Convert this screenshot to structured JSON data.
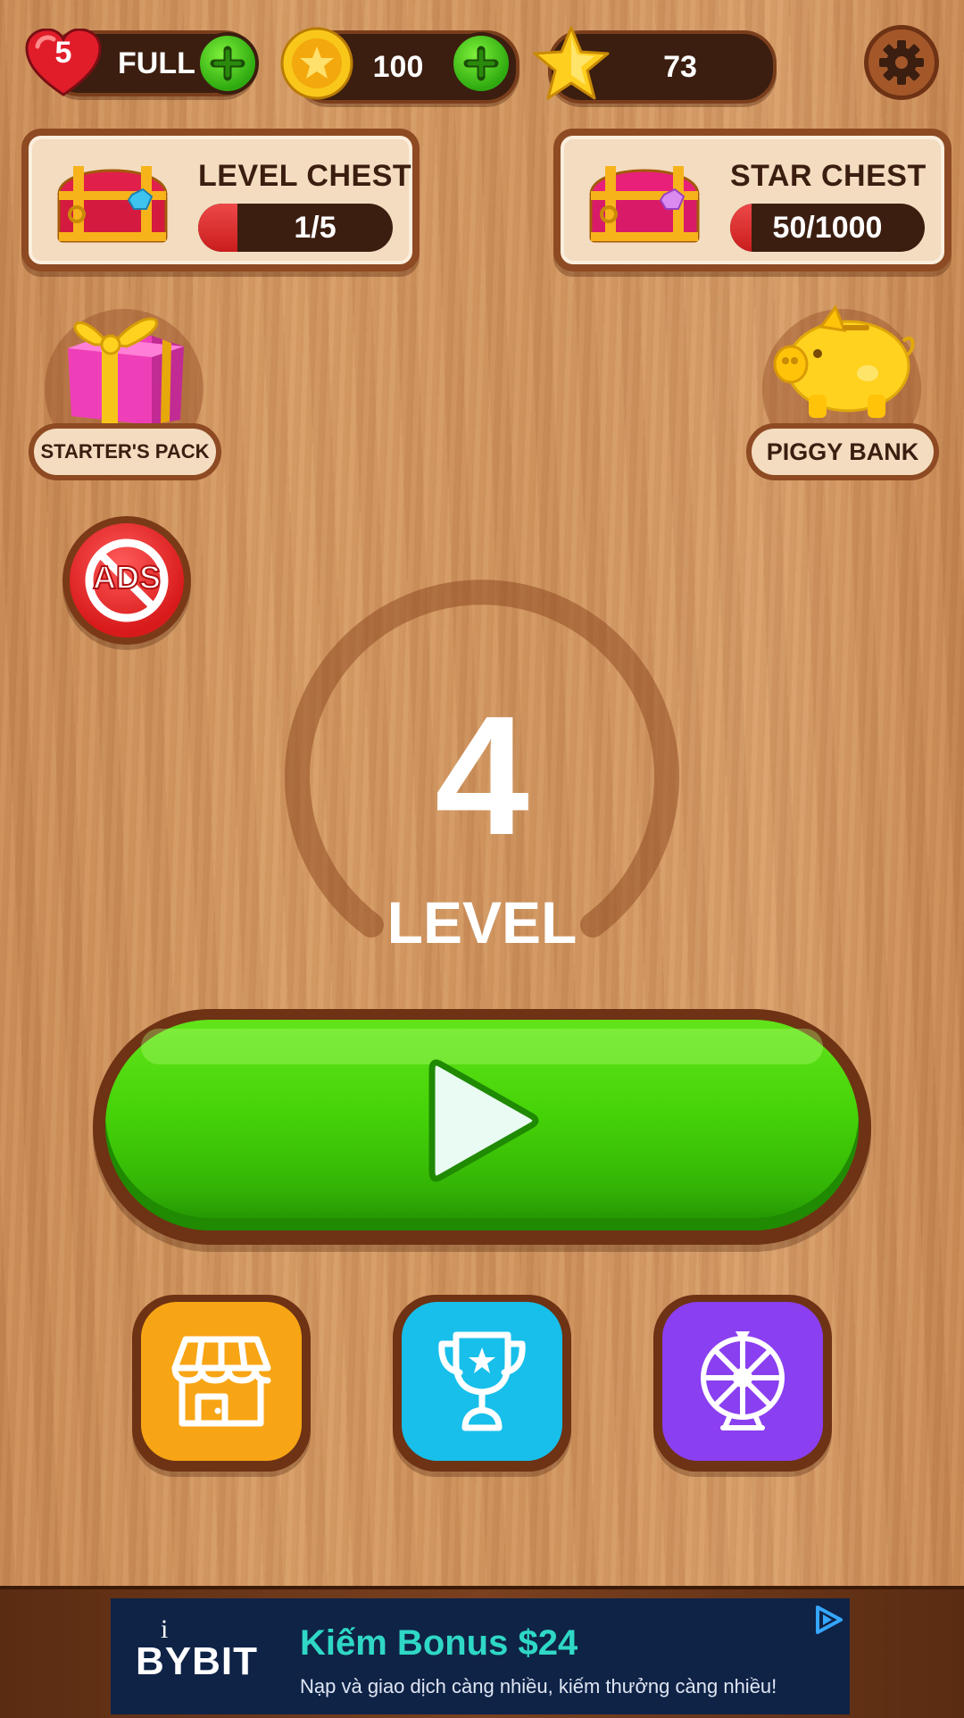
{
  "topbar": {
    "lives_count": "5",
    "lives_status": "FULL",
    "coins": "100",
    "stars": "73",
    "icons": [
      "heart-icon",
      "coin-icon",
      "star-icon",
      "plus-icon",
      "gear-icon"
    ]
  },
  "chests": {
    "level": {
      "title": "LEVEL CHEST",
      "progress_text": "1/5",
      "progress": 0.2
    },
    "star": {
      "title": "STAR CHEST",
      "progress_text": "50/1000",
      "progress": 0.05
    }
  },
  "side": {
    "starter_pack_label": "STARTER'S PACK",
    "piggy_bank_label": "PIGGY BANK",
    "no_ads_label": "ADS"
  },
  "level": {
    "number": "4",
    "label": "LEVEL"
  },
  "bottom_buttons": {
    "shop_color": "#f7a515",
    "trophy_color": "#17bfea",
    "wheel_color": "#8a3ff0"
  },
  "ad": {
    "brand": "BYBIT",
    "headline": "Kiếm Bonus $24",
    "subtext": "Nạp và giao dịch càng nhiều, kiếm thưởng càng nhiều!",
    "info_mark": "i"
  },
  "colors": {
    "play_green": "#45d308",
    "wood_dark": "#3b1e10"
  }
}
